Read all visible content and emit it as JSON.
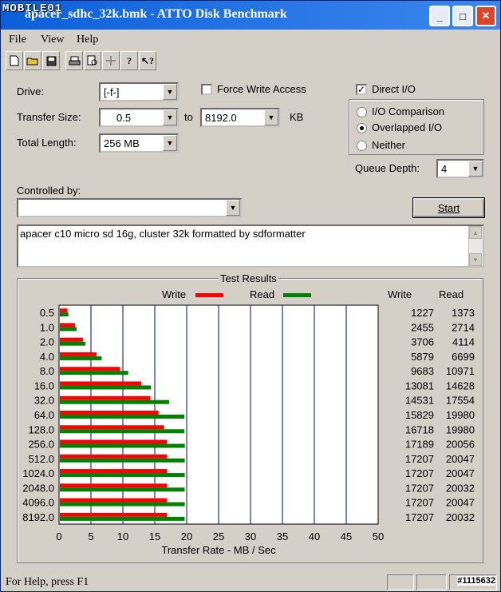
{
  "window": {
    "title": "apacer_sdhc_32k.bmk - ATTO Disk Benchmark",
    "watermark_logo": "MOBILE01",
    "controls": {
      "minimize": "_",
      "maximize": "□",
      "close": "✕"
    }
  },
  "menu": [
    "File",
    "View",
    "Help"
  ],
  "toolbar": {
    "icons": [
      "new-file-icon",
      "open-folder-icon",
      "save-icon",
      "print-icon",
      "print-preview-icon",
      "move-icon",
      "help-icon",
      "context-help-icon"
    ]
  },
  "form": {
    "drive_label": "Drive:",
    "drive_value": "[-f-]",
    "force_write_label": "Force Write Access",
    "force_write_checked": false,
    "direct_io_label": "Direct I/O",
    "direct_io_checked": true,
    "transfer_size_label": "Transfer Size:",
    "transfer_from": "0.5",
    "transfer_to_label": "to",
    "transfer_to": "8192.0",
    "transfer_unit": "KB",
    "total_length_label": "Total Length:",
    "total_length_value": "256 MB",
    "io_mode_options": [
      "I/O Comparison",
      "Overlapped I/O",
      "Neither"
    ],
    "io_mode_selected": "Overlapped I/O",
    "queue_depth_label": "Queue Depth:",
    "queue_depth_value": "4",
    "controlled_by_label": "Controlled by:",
    "controlled_by_value": "",
    "start_button": "Start",
    "description": "apacer c10 micro sd 16g, cluster 32k formatted by sdformatter"
  },
  "results": {
    "title": "Test Results",
    "write_legend": "Write",
    "read_legend": "Read",
    "col_write": "Write",
    "col_read": "Read",
    "colors": {
      "write": "#ff0000",
      "read": "#008000",
      "grid": "#000080"
    }
  },
  "chart_data": {
    "type": "bar",
    "orientation": "horizontal",
    "categories": [
      "0.5",
      "1.0",
      "2.0",
      "4.0",
      "8.0",
      "16.0",
      "32.0",
      "64.0",
      "128.0",
      "256.0",
      "512.0",
      "1024.0",
      "2048.0",
      "4096.0",
      "8192.0"
    ],
    "series": [
      {
        "name": "Write",
        "values": [
          1227,
          2455,
          3706,
          5879,
          9683,
          13081,
          14531,
          15829,
          16718,
          17189,
          17207,
          17207,
          17207,
          17207,
          17207
        ]
      },
      {
        "name": "Read",
        "values": [
          1373,
          2714,
          4114,
          6699,
          10971,
          14628,
          17554,
          19980,
          19980,
          20056,
          20047,
          20047,
          20032,
          20047,
          20032
        ]
      }
    ],
    "xlabel": "Transfer Rate - MB / Sec",
    "xticks": [
      "0",
      "5",
      "10",
      "15",
      "20",
      "25",
      "30",
      "35",
      "40",
      "45",
      "50"
    ],
    "xlim": [
      0,
      50
    ],
    "value_unit": "KB/s",
    "grid": true
  },
  "status": {
    "text": "For Help, press F1",
    "watermark_id": "#1115632"
  }
}
